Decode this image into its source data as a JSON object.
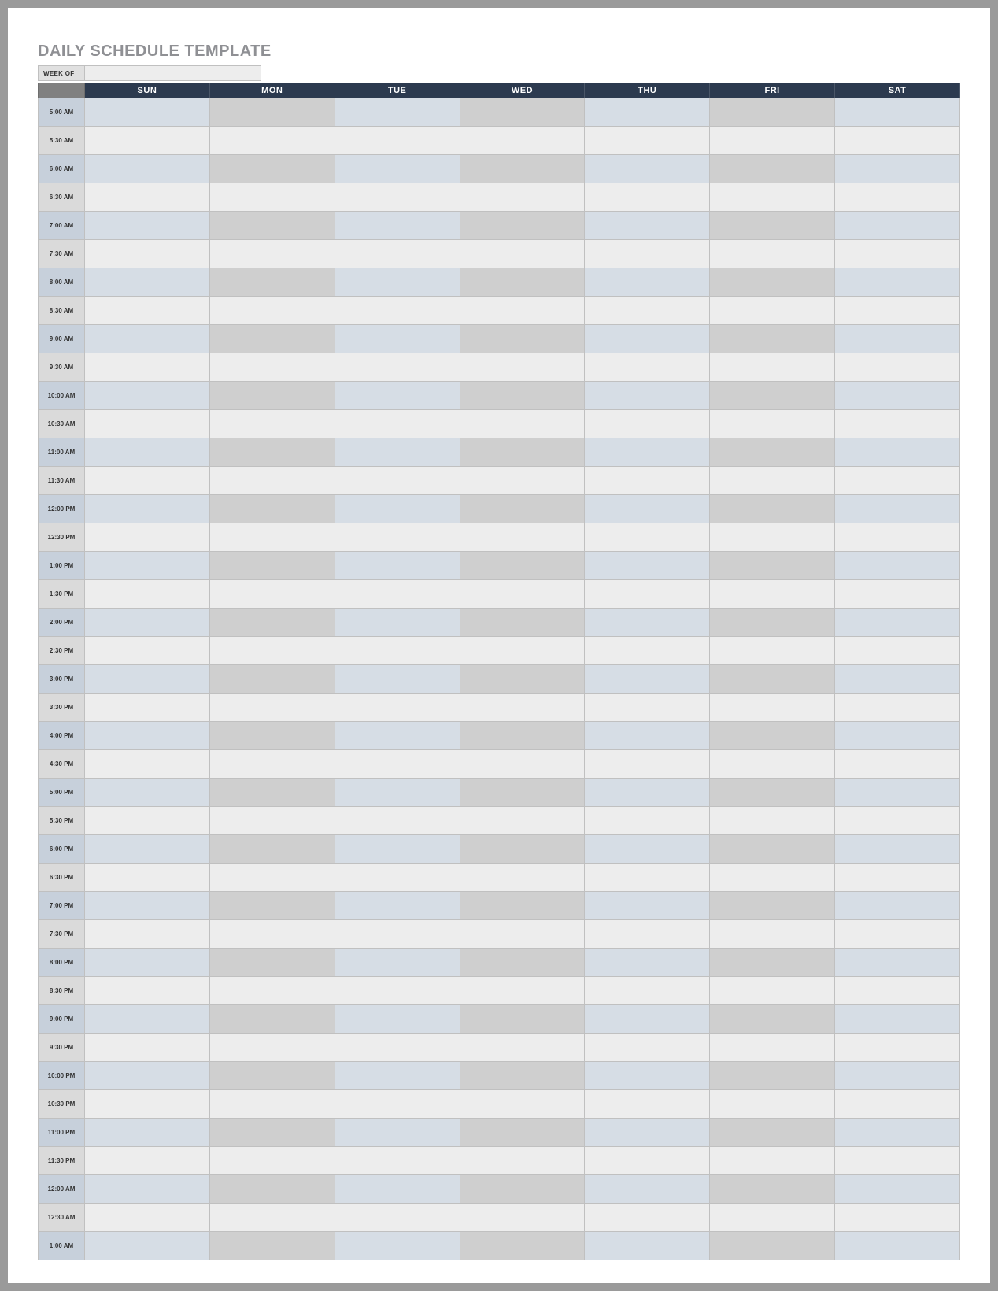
{
  "title": "DAILY SCHEDULE TEMPLATE",
  "week_of_label": "WEEK OF",
  "week_of_value": "",
  "days": [
    "SUN",
    "MON",
    "TUE",
    "WED",
    "THU",
    "FRI",
    "SAT"
  ],
  "times": [
    "5:00 AM",
    "5:30 AM",
    "6:00 AM",
    "6:30 AM",
    "7:00 AM",
    "7:30 AM",
    "8:00 AM",
    "8:30 AM",
    "9:00 AM",
    "9:30 AM",
    "10:00 AM",
    "10:30 AM",
    "11:00 AM",
    "11:30 AM",
    "12:00 PM",
    "12:30 PM",
    "1:00 PM",
    "1:30 PM",
    "2:00 PM",
    "2:30 PM",
    "3:00 PM",
    "3:30 PM",
    "4:00 PM",
    "4:30 PM",
    "5:00 PM",
    "5:30 PM",
    "6:00 PM",
    "6:30 PM",
    "7:00 PM",
    "7:30 PM",
    "8:00 PM",
    "8:30 PM",
    "9:00 PM",
    "9:30 PM",
    "10:00 PM",
    "10:30 PM",
    "11:00 PM",
    "11:30 PM",
    "12:00 AM",
    "12:30 AM",
    "1:00 AM"
  ]
}
